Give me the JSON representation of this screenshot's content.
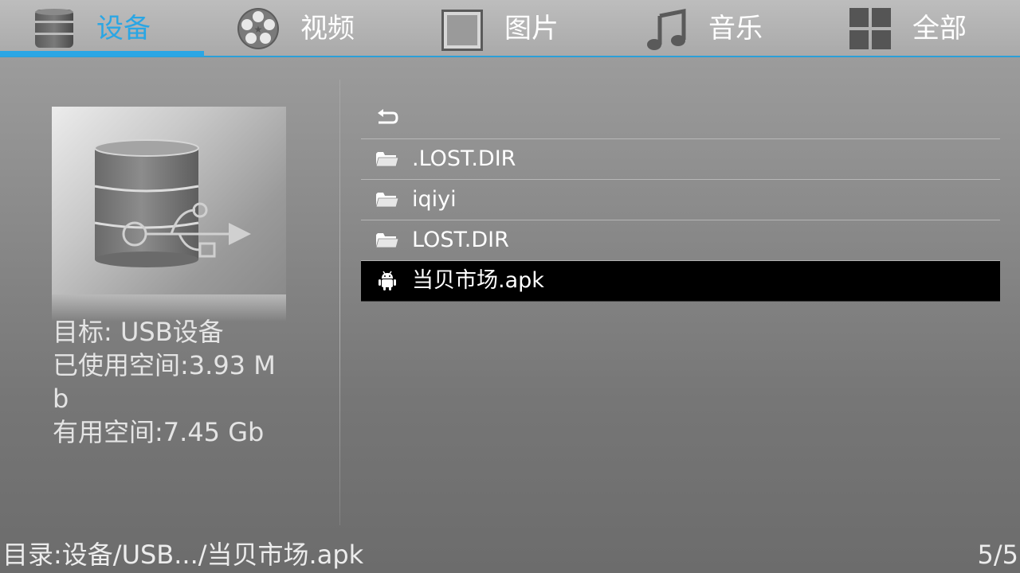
{
  "tabs": [
    {
      "label": "设备",
      "icon": "database-icon",
      "active": true
    },
    {
      "label": "视频",
      "icon": "film-reel-icon",
      "active": false
    },
    {
      "label": "图片",
      "icon": "picture-frame-icon",
      "active": false
    },
    {
      "label": "音乐",
      "icon": "music-note-icon",
      "active": false
    },
    {
      "label": "全部",
      "icon": "grid-icon",
      "active": false
    }
  ],
  "device_panel": {
    "image_icon": "usb-storage-icon",
    "target": "目标: USB设备",
    "used_space": "已使用空间:3.93 Mb",
    "free_space": "有用空间:7.45 Gb"
  },
  "file_list": [
    {
      "label": "",
      "icon": "back-arrow-icon",
      "selected": false
    },
    {
      "label": ".LOST.DIR",
      "icon": "folder-icon",
      "selected": false
    },
    {
      "label": "iqiyi",
      "icon": "folder-icon",
      "selected": false
    },
    {
      "label": "LOST.DIR",
      "icon": "folder-icon",
      "selected": false
    },
    {
      "label": "当贝市场.apk",
      "icon": "android-icon",
      "selected": true
    }
  ],
  "status": {
    "path": "目录:设备/USB.../当贝市场.apk",
    "page": "5/5"
  },
  "colors": {
    "accent": "#2aa6e4",
    "selected_row": "#000000"
  }
}
